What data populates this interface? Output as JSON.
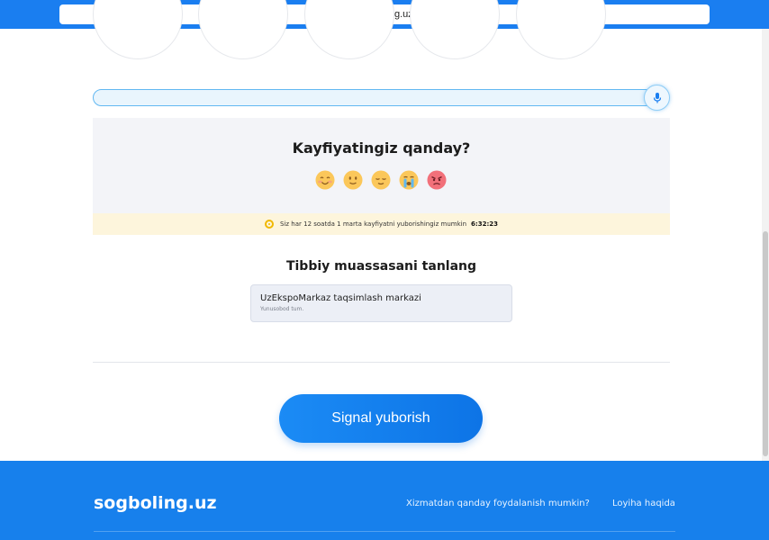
{
  "browser": {
    "url": "Sogboling.uz"
  },
  "search": {
    "placeholder": ""
  },
  "mood": {
    "title": "Kayfiyatingiz qanday?",
    "emojis": [
      "smiling-face-icon",
      "slightly-smiling-face-icon",
      "relieved-face-icon",
      "crying-face-icon",
      "angry-face-icon"
    ],
    "notice_text": "Siz har 12 soatda 1 marta kayfiyatni yuborishingiz mumkin",
    "timer": "6:32:23"
  },
  "institution": {
    "title": "Tibbiy muassasani tanlang",
    "selected_name": "UzEkspoMarkaz taqsimlash markazi",
    "selected_district": "Yunusobod tum."
  },
  "actions": {
    "send_label": "Signal yuboris​h"
  },
  "footer": {
    "logo": "sogboling.uz",
    "links": [
      "Xizmatdan qanday foydalanish mumkin?",
      "Loyiha haqida"
    ]
  },
  "colors": {
    "brand": "#1780ec",
    "notice_bg": "#fdf5dc",
    "panel_bg": "#f3f4f8"
  }
}
